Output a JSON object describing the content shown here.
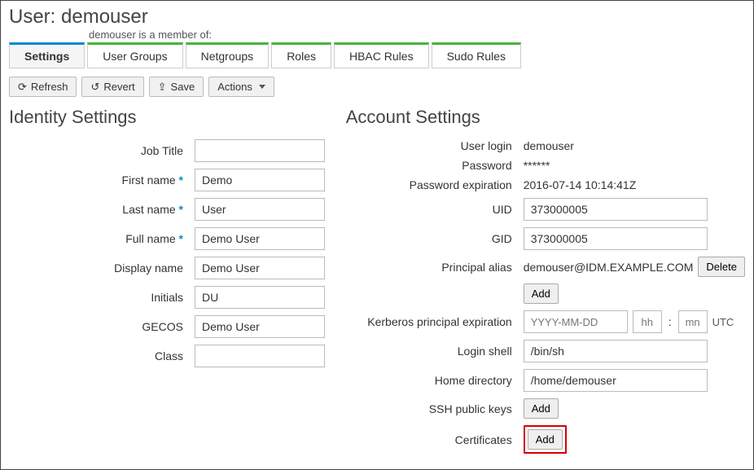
{
  "header": {
    "title_prefix": "User: ",
    "username": "demouser",
    "member_of_label": "demouser is a member of:"
  },
  "tabs": {
    "settings": "Settings",
    "user_groups": "User Groups",
    "netgroups": "Netgroups",
    "roles": "Roles",
    "hbac_rules": "HBAC Rules",
    "sudo_rules": "Sudo Rules"
  },
  "toolbar": {
    "refresh": "Refresh",
    "revert": "Revert",
    "save": "Save",
    "actions": "Actions"
  },
  "identity": {
    "section_title": "Identity Settings",
    "labels": {
      "job_title": "Job Title",
      "first_name": "First name",
      "last_name": "Last name",
      "full_name": "Full name",
      "display_name": "Display name",
      "initials": "Initials",
      "gecos": "GECOS",
      "class": "Class"
    },
    "values": {
      "job_title": "",
      "first_name": "Demo",
      "last_name": "User",
      "full_name": "Demo User",
      "display_name": "Demo User",
      "initials": "DU",
      "gecos": "Demo User",
      "class": ""
    }
  },
  "account": {
    "section_title": "Account Settings",
    "labels": {
      "user_login": "User login",
      "password": "Password",
      "password_expiration": "Password expiration",
      "uid": "UID",
      "gid": "GID",
      "principal_alias": "Principal alias",
      "kerberos_exp": "Kerberos principal expiration",
      "login_shell": "Login shell",
      "home_dir": "Home directory",
      "ssh_keys": "SSH public keys",
      "certificates": "Certificates"
    },
    "values": {
      "user_login": "demouser",
      "password": "******",
      "password_expiration": "2016-07-14 10:14:41Z",
      "uid": "373000005",
      "gid": "373000005",
      "principal_alias": "demouser@IDM.EXAMPLE.COM",
      "login_shell": "/bin/sh",
      "home_dir": "/home/demouser"
    },
    "placeholders": {
      "krb_date": "YYYY-MM-DD",
      "krb_hh": "hh",
      "krb_mn": "mn"
    },
    "buttons": {
      "delete": "Delete",
      "add": "Add"
    },
    "utc": "UTC"
  }
}
